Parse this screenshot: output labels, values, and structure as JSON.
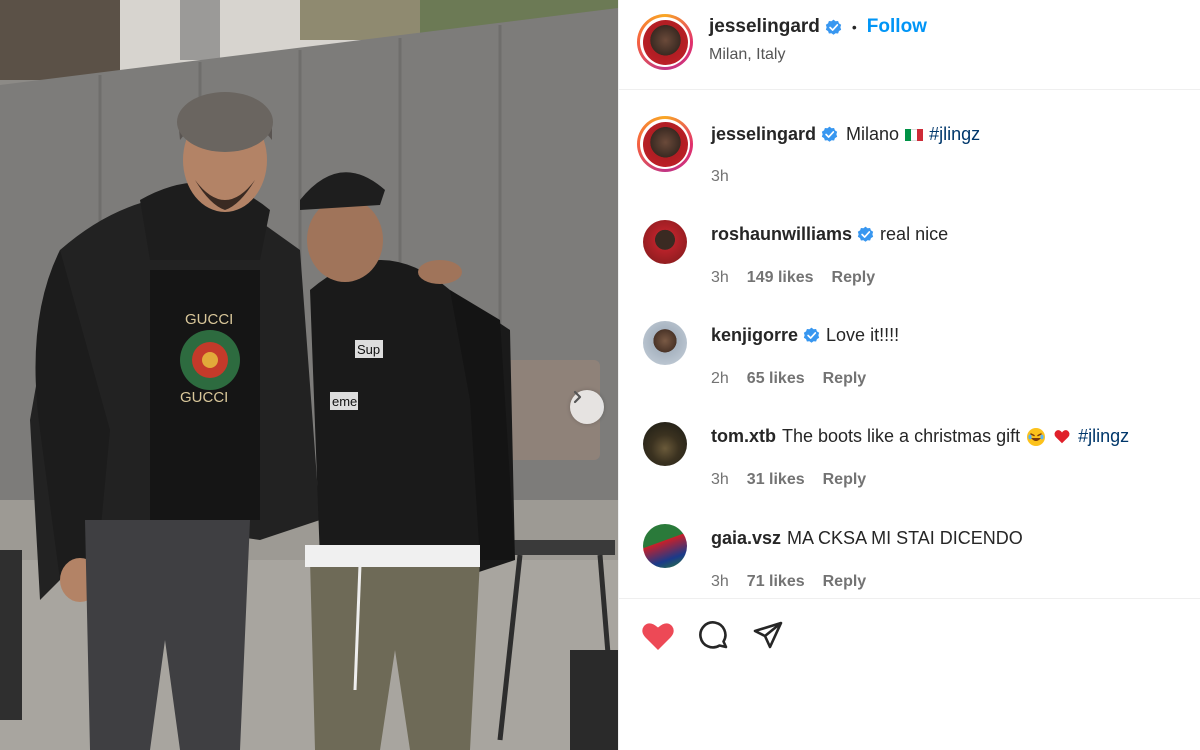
{
  "post": {
    "author": "jesselingard",
    "location": "Milan, Italy",
    "follow_label": "Follow",
    "separator": "•",
    "caption": {
      "username": "jesselingard",
      "text": "Milano",
      "hashtag": "#jlingz",
      "time": "3h"
    },
    "photo": {
      "hoodie_logo_1": "Sup",
      "hoodie_logo_2": "eme",
      "shirt_text_top": "GUCCI",
      "shirt_text_bottom": "GUCCI"
    }
  },
  "comments": [
    {
      "username": "roshaunwilliams",
      "verified": true,
      "text": "real nice",
      "hashtag": "",
      "time": "3h",
      "likes": "149 likes",
      "reply": "Reply"
    },
    {
      "username": "kenjigorre",
      "verified": true,
      "text": "Love it!!!!",
      "hashtag": "",
      "time": "2h",
      "likes": "65 likes",
      "reply": "Reply"
    },
    {
      "username": "tom.xtb",
      "verified": false,
      "text": "The boots like a christmas gift",
      "hashtag": "#jlingz",
      "time": "3h",
      "likes": "31 likes",
      "reply": "Reply"
    },
    {
      "username": "gaia.vsz",
      "verified": false,
      "text": "MA CKSA MI STAI DICENDO",
      "hashtag": "",
      "time": "3h",
      "likes": "71 likes",
      "reply": "Reply"
    }
  ],
  "icons": {
    "like": "heart-icon",
    "comment": "comment-icon",
    "share": "share-icon",
    "next": "chevron-right-icon",
    "verified": "verified-badge-icon"
  },
  "colors": {
    "link_blue": "#0095f6",
    "hashtag": "#00376b",
    "liked_red": "#ed4956",
    "verified_blue": "#0095f6",
    "muted": "#737373"
  }
}
